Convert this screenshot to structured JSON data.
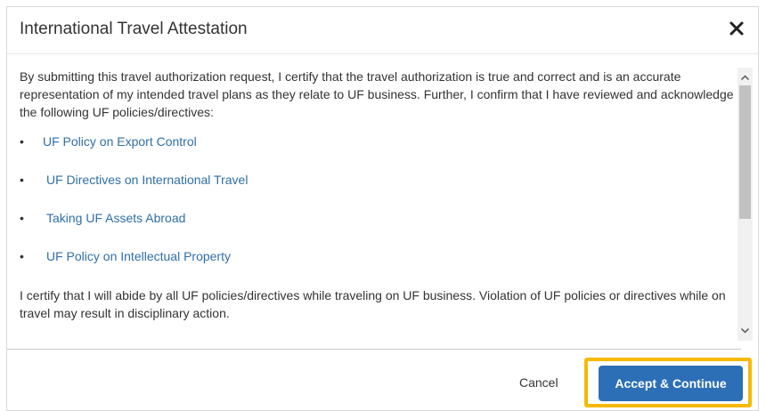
{
  "dialog": {
    "title": "International Travel Attestation",
    "close_icon": "close-icon"
  },
  "body": {
    "intro": "By submitting this travel authorization request, I certify that the travel authorization is true and correct and is an accurate representation of my intended travel plans as they relate to UF business. Further, I confirm that I have reviewed and acknowledge the following UF policies/directives:",
    "bullet": "•",
    "links": [
      {
        "label": "UF Policy on Export Control"
      },
      {
        "label": "UF Directives on International Travel"
      },
      {
        "label": "Taking UF Assets Abroad"
      },
      {
        "label": "UF Policy on Intellectual Property"
      }
    ],
    "closing": "I certify that I will abide by all UF policies/directives while traveling on UF business. Violation of UF policies or directives while on travel may result in disciplinary action."
  },
  "footer": {
    "cancel_label": "Cancel",
    "accept_label": "Accept & Continue"
  },
  "colors": {
    "link": "#2f6fa8",
    "primary_button": "#2c6fb7",
    "highlight": "#f5b900"
  }
}
